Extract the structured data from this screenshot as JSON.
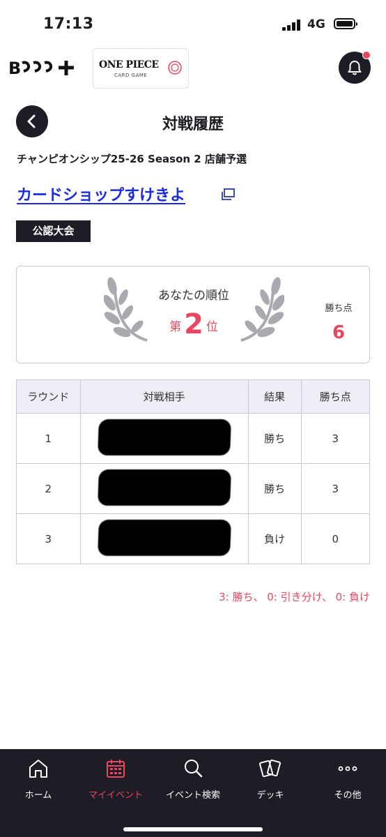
{
  "status_bar": {
    "time": "17:13",
    "network": "4G"
  },
  "header": {
    "brand_logo": "B+",
    "game_logo_main": "ONE PIECE",
    "game_logo_sub": "CARD GAME"
  },
  "page": {
    "title": "対戦履歴",
    "event_name": "チャンピオンシップ25-26 Season 2 店舗予選",
    "shop_name": "カードショップすけきよ",
    "badge": "公認大会"
  },
  "rank_card": {
    "label": "あなたの順位",
    "prefix": "第",
    "rank": "2",
    "suffix": "位",
    "points_label": "勝ち点",
    "points": "6"
  },
  "table": {
    "headers": [
      "ラウンド",
      "対戦相手",
      "結果",
      "勝ち点"
    ],
    "rows": [
      {
        "round": "1",
        "result": "勝ち",
        "points": "3"
      },
      {
        "round": "2",
        "result": "勝ち",
        "points": "3"
      },
      {
        "round": "3",
        "result": "負け",
        "points": "0"
      }
    ]
  },
  "scoring_note": "3: 勝ち、 0: 引き分け、 0: 負け",
  "nav": {
    "items": [
      {
        "label": "ホーム",
        "icon": "home-icon"
      },
      {
        "label": "マイイベント",
        "icon": "calendar-icon",
        "active": true
      },
      {
        "label": "イベント検索",
        "icon": "search-icon"
      },
      {
        "label": "デッキ",
        "icon": "cards-icon"
      },
      {
        "label": "その他",
        "icon": "more-icon"
      }
    ]
  },
  "colors": {
    "accent": "#e8475f",
    "dark": "#1e1c24",
    "link": "#1a2be0",
    "laurel": "#a9a9b0"
  }
}
